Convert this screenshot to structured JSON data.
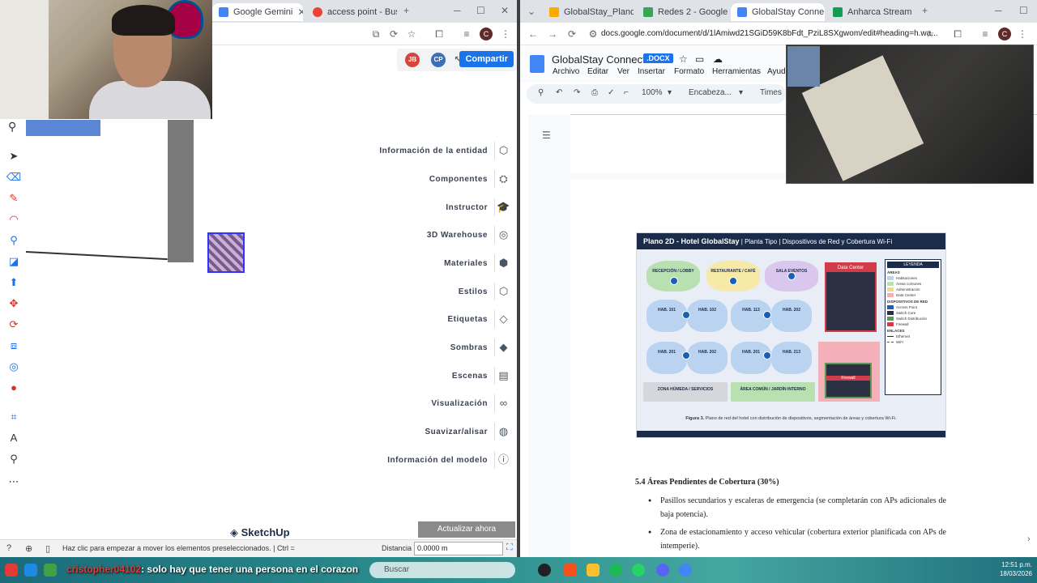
{
  "left_browser": {
    "tabs": [
      {
        "title": "Google Gemini",
        "color": "#4285f4"
      },
      {
        "title": "access point - Busc",
        "color": "#ea4335"
      }
    ],
    "new_tab": "+",
    "win_min": "─",
    "win_max": "☐",
    "win_close": "✕"
  },
  "sketchup": {
    "share_label": "Compartir",
    "avatar1": "JB",
    "avatar2": "CP",
    "panel_items": [
      {
        "label": "Información de la entidad",
        "icon": "entity-info-icon",
        "glyph": "⬡"
      },
      {
        "label": "Componentes",
        "icon": "components-icon",
        "glyph": "⛭"
      },
      {
        "label": "Instructor",
        "icon": "instructor-icon",
        "glyph": "🎓"
      },
      {
        "label": "3D Warehouse",
        "icon": "warehouse-icon",
        "glyph": "◎"
      },
      {
        "label": "Materiales",
        "icon": "materials-icon",
        "glyph": "⬢"
      },
      {
        "label": "Estilos",
        "icon": "styles-icon",
        "glyph": "⬡"
      },
      {
        "label": "Etiquetas",
        "icon": "tags-icon",
        "glyph": "◇"
      },
      {
        "label": "Sombras",
        "icon": "shadows-icon",
        "glyph": "◆"
      },
      {
        "label": "Escenas",
        "icon": "scenes-icon",
        "glyph": "▤"
      },
      {
        "label": "Visualización",
        "icon": "display-icon",
        "glyph": "∞"
      },
      {
        "label": "Suavizar/alisar",
        "icon": "smooth-icon",
        "glyph": "◍"
      },
      {
        "label": "Información del modelo",
        "icon": "model-info-icon",
        "glyph": "ⓘ"
      }
    ],
    "update_button": "Actualizar ahora",
    "logo_text": "SketchUp",
    "status_text": "Haz clic para empezar a mover los elementos preseleccionados. | Ctrl =",
    "distance_label": "Distancia",
    "distance_value": "0.0000 m"
  },
  "right_browser": {
    "tabs": [
      {
        "title": "GlobalStay_Plano2D",
        "color": "#f9ab00"
      },
      {
        "title": "Redes 2 - Google D",
        "color": "#34a853"
      },
      {
        "title": "GlobalStay Conne",
        "color": "#4285f4"
      },
      {
        "title": "Anharca Stream",
        "color": "#0f9d58"
      }
    ],
    "url": "docs.google.com/document/d/1lAmiwd21SGiD59K8bFdt_PziL8SXgwom/edit#heading=h.wa..."
  },
  "docs": {
    "title": "GlobalStay Connect",
    "badge": ".DOCX",
    "menu": [
      "Archivo",
      "Editar",
      "Ver",
      "Insertar",
      "Formato",
      "Herramientas",
      "Ayud"
    ],
    "zoom": "100%",
    "style": "Encabeza...",
    "font": "Times",
    "figure": {
      "header_bold": "Plano 2D - Hotel GlobalStay",
      "header_rest": "| Planta Tipo | Dispositivos de Red y Cobertura Wi-Fi",
      "rooms_top": [
        "RECEPCIÓN / LOBBY",
        "RESTAURANTE / CAFÉ",
        "SALA EVENTOS"
      ],
      "rooms_mid": [
        "HAB. 101",
        "HAB. 102",
        "HAB. 113",
        "HAB. 202"
      ],
      "rooms_low": [
        "HAB. 201",
        "HAB. 202",
        "HAB. 201",
        "HAB. 213"
      ],
      "zones": [
        "ZONA HÚMEDA / SERVICIOS",
        "ÁREA COMÚN / JARDÍN INTERNO"
      ],
      "datacenter": "Data Center",
      "firewall": "Firewall",
      "legend_title": "LEYENDA",
      "legend_areas_title": "ÁREAS",
      "legend_areas": [
        {
          "label": "Habitaciones",
          "color": "#b9d3f0"
        },
        {
          "label": "Áreas comunes",
          "color": "#b8e0b0"
        },
        {
          "label": "Administración",
          "color": "#f0d98a"
        },
        {
          "label": "Data Center",
          "color": "#f3b0b8"
        }
      ],
      "legend_devices_title": "DISPOSITIVOS DE RED",
      "legend_devices": [
        "Access Point",
        "Switch Core",
        "Switch Distribución",
        "Firewall"
      ],
      "legend_links_title": "ENLACES",
      "legend_links": [
        "Ethernet",
        "WiFi"
      ],
      "caption_bold": "Figura 3.",
      "caption": "Plano de red del hotel con distribución de dispositivos, segmentación de áreas y cobertura Wi-Fi."
    },
    "section_title": "5.4 Áreas Pendientes de Cobertura (30%)",
    "bullets": [
      "Pasillos secundarios y escaleras de emergencia (se completarán con APs adicionales de baja potencia).",
      "Zona de estacionamiento y acceso vehicular (cobertura exterior planificada con APs de intemperie)."
    ]
  },
  "taskbar": {
    "chat_user": "cristopher04102",
    "chat_message": ": solo hay que tener una persona en el corazon",
    "search_placeholder": "Buscar",
    "time": "12:51 p.m.",
    "date": "18/03/2026"
  }
}
